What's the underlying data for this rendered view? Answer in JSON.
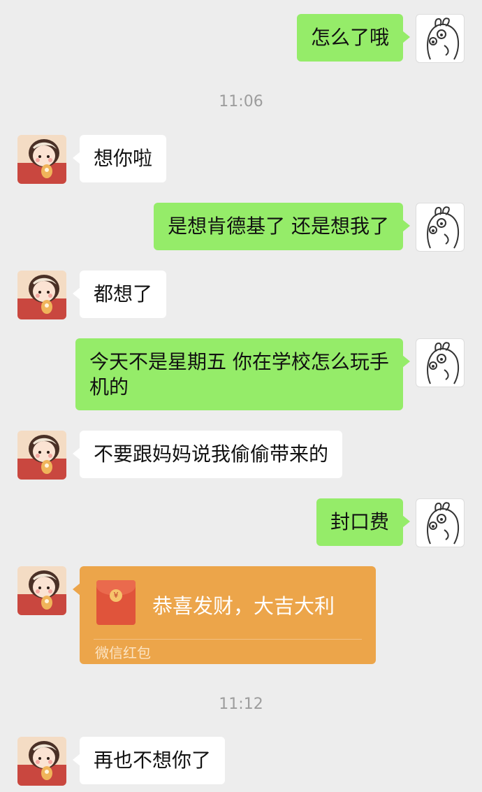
{
  "chat": {
    "messages": [
      {
        "sender": "me",
        "text": "怎么了哦"
      },
      {
        "sender": "them",
        "text": "想你啦"
      },
      {
        "sender": "me",
        "text": "是想肯德基了 还是想我了"
      },
      {
        "sender": "them",
        "text": "都想了"
      },
      {
        "sender": "me",
        "text": "今天不是星期五 你在学校怎么玩手机的"
      },
      {
        "sender": "them",
        "text": "不要跟妈妈说我偷偷带来的"
      },
      {
        "sender": "me",
        "text": "封口费"
      },
      {
        "sender": "them",
        "text": "再也不想你了"
      }
    ],
    "timestamps": [
      "11:06",
      "11:12"
    ],
    "red_packet": {
      "greeting": "恭喜发财，大吉大利",
      "label": "微信红包",
      "coin_glyph": "¥"
    }
  },
  "colors": {
    "background": "#ededed",
    "my_bubble": "#95ec69",
    "their_bubble": "#ffffff",
    "red_packet": "#eca54a"
  }
}
